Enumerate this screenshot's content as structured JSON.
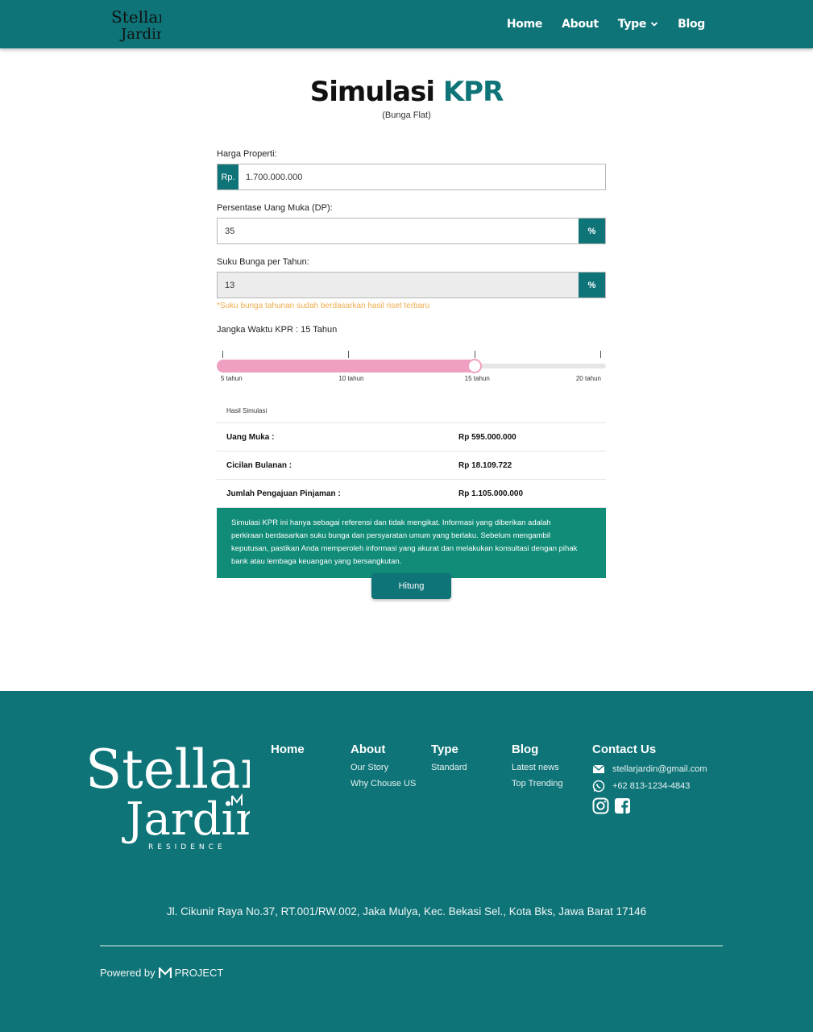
{
  "nav": {
    "logo_line1": "Stellar",
    "logo_line2": "Jardin",
    "links": [
      "Home",
      "About",
      "Type",
      "Blog"
    ]
  },
  "page": {
    "title_part1": "Simulasi",
    "title_part2": "KPR",
    "subtitle": "(Bunga Flat)"
  },
  "form": {
    "price_label": "Harga Properti:",
    "price_prefix": "Rp.",
    "price_value": "1.700.000.000",
    "dp_label": "Persentase Uang Muka (DP):",
    "dp_value": "35",
    "dp_suffix": "%",
    "rate_label": "Suku Bunga per Tahun:",
    "rate_value": "13",
    "rate_suffix": "%",
    "rate_note": "*Suku bunga tahunan sudah berdasarkan hasil riset terbaru",
    "term_label": "Jangka Waktu KPR : 15 Tahun",
    "term_value": 15,
    "term_min": 5,
    "term_max": 20,
    "term_ticks": [
      "5 tahun",
      "10 tahun",
      "15 tahun",
      "20 tahun"
    ]
  },
  "result": {
    "title": "Hasil Simulasi",
    "rows": [
      {
        "label": "Uang Muka :",
        "value": "Rp 595.000.000"
      },
      {
        "label": "Cicilan Bulanan :",
        "value": "Rp 18.109.722"
      },
      {
        "label": "Jumlah Pengajuan Pinjaman :",
        "value": "Rp 1.105.000.000"
      }
    ],
    "disclaimer": "Simulasi KPR ini hanya sebagai referensi dan tidak mengikat. Informasi yang diberikan adalah perkiraan berdasarkan suku bunga dan persyaratan umum yang berlaku. Sebelum mengambil keputusan, pastikan Anda memperoleh informasi yang akurat dan melakukan konsultasi dengan pihak bank atau lembaga keuangan yang bersangkutan."
  },
  "button": {
    "label": "Hitung"
  },
  "footer": {
    "logo_line1": "Stellar",
    "logo_line2": "Jardin",
    "logo_tag": "RESIDENCE",
    "col_home": "Home",
    "col_about": "About",
    "about_links": [
      "Our Story",
      "Why Chouse US"
    ],
    "col_type": "Type",
    "type_links": [
      "Standard"
    ],
    "col_blog": "Blog",
    "blog_links": [
      "Latest news",
      "Top Trending"
    ],
    "col_contact": "Contact Us",
    "email": "stellarjardin@gmail.com",
    "phone": "+62 813-1234-4843",
    "address": "Jl. Cikunir Raya No.37, RT.001/RW.002, Jaka Mulya, Kec. Bekasi Sel., Kota Bks, Jawa Barat 17146",
    "powered_by": "Powered by",
    "powered_brand": "PROJECT"
  },
  "colors": {
    "primary": "#0e7478",
    "accent_pink": "#ef9fbf",
    "note_orange": "#f0ad4e",
    "disclaimer_bg": "#118c78"
  },
  "icons": [
    "chevron-down-icon",
    "email-icon",
    "whatsapp-icon",
    "instagram-icon",
    "facebook-icon",
    "project-logo-icon"
  ]
}
